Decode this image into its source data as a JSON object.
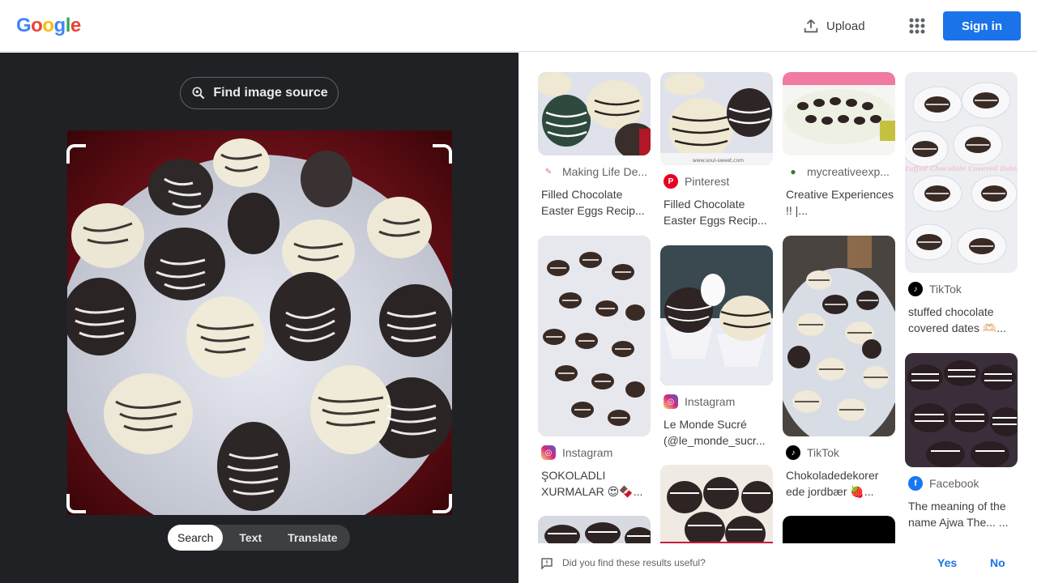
{
  "header": {
    "logo_letters": [
      "G",
      "o",
      "o",
      "g",
      "l",
      "e"
    ],
    "logo_colors": [
      "#4285f4",
      "#ea4335",
      "#fbbc05",
      "#4285f4",
      "#34a853",
      "#ea4335"
    ],
    "upload_label": "Upload",
    "signin_label": "Sign in"
  },
  "left": {
    "find_source_label": "Find image source",
    "modes": [
      "Search",
      "Text",
      "Translate"
    ],
    "active_mode": "Search"
  },
  "results": [
    {
      "source": "Making Life De...",
      "title": "Filled Chocolate Easter Eggs Recip...",
      "icon": "making-life-icon",
      "icon_color": "#e57373",
      "thumb": "eggs"
    },
    {
      "source": "Pinterest",
      "title": "Filled Chocolate Easter Eggs Recip...",
      "icon": "pinterest-icon",
      "icon_color": "#e60023",
      "thumb": "eggs2"
    },
    {
      "source": "mycreativeexp...",
      "title": "Creative Experiences !! |...",
      "icon": "mycreative-icon",
      "icon_color": "#2e7d32",
      "thumb": "plate"
    },
    {
      "source": "TikTok",
      "title": "stuffed chocolate covered dates 🫶🏻...",
      "icon": "tiktok-icon",
      "icon_color": "#000000",
      "thumb": "dates-white",
      "overlay": "Stuffed Chocolate Covered Dates"
    },
    {
      "source": "Instagram",
      "title": "ŞOKOLADLI XURMALAR 😍🍫...",
      "icon": "instagram-icon",
      "icon_color": "#d62976",
      "thumb": "many"
    },
    {
      "source": "Instagram",
      "title": "Le Monde Sucré (@le_monde_sucr...",
      "icon": "instagram-icon",
      "icon_color": "#d62976",
      "thumb": "cups"
    },
    {
      "source": "TikTok",
      "title": "Chokoladedekorer ede jordbær 🍓...",
      "icon": "tiktok-icon",
      "icon_color": "#000000",
      "thumb": "tray"
    },
    {
      "source": "Facebook",
      "title": "The meaning of the name Ajwa The... ...",
      "icon": "facebook-icon",
      "icon_color": "#1877f2",
      "thumb": "dark"
    }
  ],
  "feedback": {
    "question": "Did you find these results useful?",
    "yes_label": "Yes",
    "no_label": "No"
  }
}
